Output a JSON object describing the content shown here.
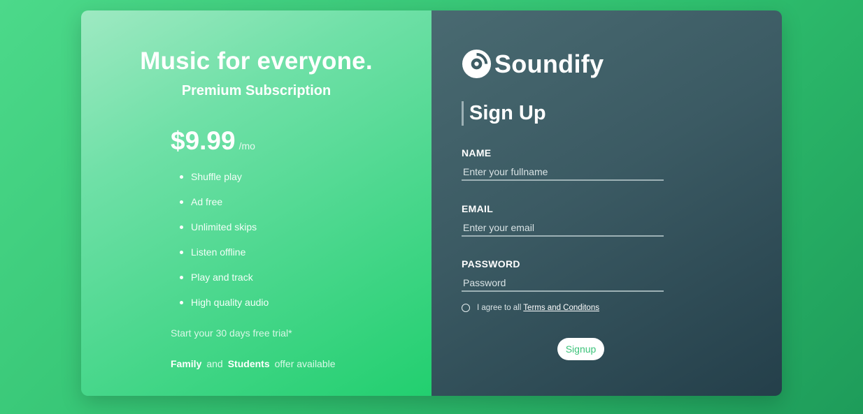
{
  "promo": {
    "headline": "Music for everyone.",
    "subheadline": "Premium Subscription",
    "price": "$9.99",
    "period": "/mo",
    "features": [
      "Shuffle play",
      "Ad free",
      "Unlimited skips",
      "Listen offline",
      "Play and track",
      "High quality audio"
    ],
    "trial_text": "Start your 30 days free trial*",
    "offer": {
      "family": "Family",
      "and": "and",
      "students": "Students",
      "suffix": "offer available"
    }
  },
  "brand": {
    "name": "Soundify",
    "icon": "disc-icon"
  },
  "form": {
    "title": "Sign Up",
    "name_label": "NAME",
    "name_placeholder": "Enter your fullname",
    "name_value": "",
    "email_label": "EMAIL",
    "email_placeholder": "Enter your email",
    "email_value": "",
    "password_label": "PASSWORD",
    "password_placeholder": "Password",
    "password_value": "",
    "terms_prefix": "I agree to all",
    "terms_link": "Terms and Conditons",
    "terms_checked": false,
    "submit_label": "Signup"
  },
  "colors": {
    "accent_green": "#3cc37a",
    "panel_dark": "#2f4b55",
    "background": "#33c475"
  }
}
